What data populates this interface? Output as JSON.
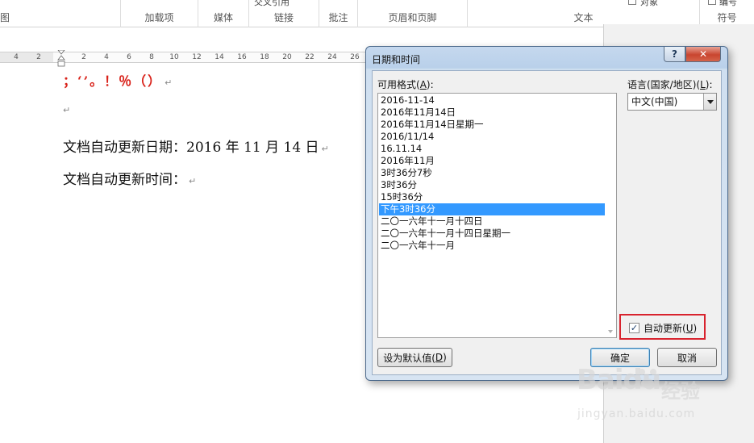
{
  "ribbon": {
    "groups": [
      {
        "label": "图"
      },
      {
        "label": "加载项"
      },
      {
        "label": "媒体"
      },
      {
        "label": "链接"
      },
      {
        "label": "批注"
      },
      {
        "label": "页眉和页脚"
      },
      {
        "label": "文本"
      },
      {
        "label": "符号"
      }
    ],
    "top_items": {
      "cross_ref": "交叉引用",
      "align": "对象",
      "number": "编号"
    }
  },
  "ruler": {
    "ticks": [
      "4",
      "2",
      "2",
      "4",
      "6",
      "8",
      "10",
      "12",
      "14",
      "16",
      "18",
      "20",
      "22",
      "24",
      "26"
    ]
  },
  "document": {
    "symbols_line": "；‘’。！％（）",
    "para_mark": "↵",
    "line1": "文档自动更新日期：2016 年 11 月 14 日",
    "line2": "文档自动更新时间："
  },
  "dialog": {
    "title": "日期和时间",
    "help_label": "?",
    "close_label": "✕",
    "formats_label": "可用格式(",
    "formats_key": "A",
    "formats_tail": "):",
    "formats": [
      "2016-11-14",
      "2016年11月14日",
      "2016年11月14日星期一",
      "2016/11/14",
      "16.11.14",
      "2016年11月",
      "3时36分7秒",
      "3时36分",
      "15时36分",
      "下午3时36分",
      "二〇一六年十一月十四日",
      "二〇一六年十一月十四日星期一",
      "二〇一六年十一月"
    ],
    "selected_index": 9,
    "language_label": "语言(国家/地区)(",
    "language_key": "L",
    "language_tail": "):",
    "language_value": "中文(中国)",
    "auto_update_label": "自动更新(",
    "auto_update_key": "U",
    "auto_update_tail": ")",
    "auto_update_checked": true,
    "check_mark": "✓",
    "set_default_label": "设为默认值(",
    "set_default_key": "D",
    "set_default_tail": ")",
    "ok_label": "确定",
    "cancel_label": "取消"
  },
  "watermark": {
    "brand": "Baidu",
    "cn": "经验",
    "url": "jingyan.baidu.com"
  },
  "colors": {
    "accent_red": "#d9231b",
    "selection_blue": "#3399ff",
    "highlight_box": "#d8232e"
  }
}
